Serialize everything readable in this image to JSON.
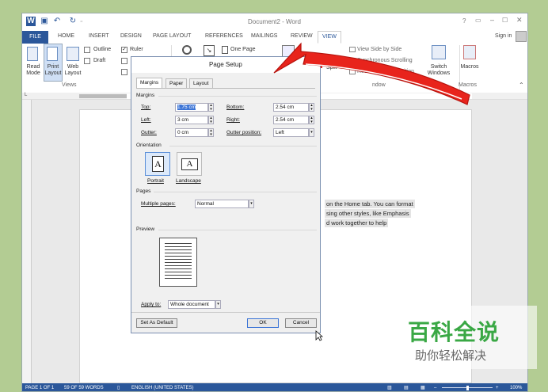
{
  "title": "Document2 - Word",
  "signin": "Sign in",
  "window_controls": [
    "?",
    "▭",
    "–",
    "☐",
    "✕"
  ],
  "ribbon_tabs": [
    "FILE",
    "HOME",
    "INSERT",
    "DESIGN",
    "PAGE LAYOUT",
    "REFERENCES",
    "MAILINGS",
    "REVIEW",
    "VIEW"
  ],
  "active_tab": "VIEW",
  "views": {
    "read_mode": "Read\nMode",
    "print_layout": "Print\nLayout",
    "web_layout": "Web\nLayout",
    "group": "Views",
    "outline": "Outline",
    "draft": "Draft"
  },
  "show": {
    "ruler": "Ruler"
  },
  "zoom": {
    "one_page": "One Page"
  },
  "window_group": {
    "view_side_by_side": "View Side by Side",
    "sync_scrolling": "Synchronous Scrolling",
    "reset_position": "Reset Window Position",
    "split": "Split",
    "switch_windows": "Switch\nWindows",
    "group": "ndow"
  },
  "macros": {
    "label": "Macros",
    "group": "Macros"
  },
  "dialog": {
    "title": "Page Setup",
    "tabs": [
      "Margins",
      "Paper",
      "Layout"
    ],
    "margins_heading": "Margins",
    "top_label": "Top:",
    "top_value": "1.75 cm",
    "bottom_label": "Bottom:",
    "bottom_value": "2.54 cm",
    "left_label": "Left:",
    "left_value": "3 cm",
    "right_label": "Right:",
    "right_value": "2.54 cm",
    "gutter_label": "Gutter:",
    "gutter_value": "0 cm",
    "gutter_pos_label": "Gutter position:",
    "gutter_pos_value": "Left",
    "orientation_heading": "Orientation",
    "portrait": "Portrait",
    "landscape": "Landscape",
    "pages_heading": "Pages",
    "multiple_pages_label": "Multiple pages:",
    "multiple_pages_value": "Normal",
    "preview_heading": "Preview",
    "apply_to_label": "Apply to:",
    "apply_to_value": "Whole document",
    "set_default": "Set As Default",
    "ok": "OK",
    "cancel": "Cancel"
  },
  "doc_text": [
    "on the Home tab. You can format",
    "sing other styles, like Emphasis",
    "d work together to help"
  ],
  "status": {
    "page": "PAGE 1 OF 1",
    "words": "59 OF 59 WORDS",
    "language": "ENGLISH (UNITED STATES)",
    "zoom": "100%"
  },
  "watermark": {
    "main": "百科全说",
    "sub": "助你轻松解决"
  },
  "colors": {
    "word_blue": "#2b579a",
    "arrow_red": "#e8241c",
    "watermark_green": "#3aa845",
    "background": "#b3cc93"
  }
}
